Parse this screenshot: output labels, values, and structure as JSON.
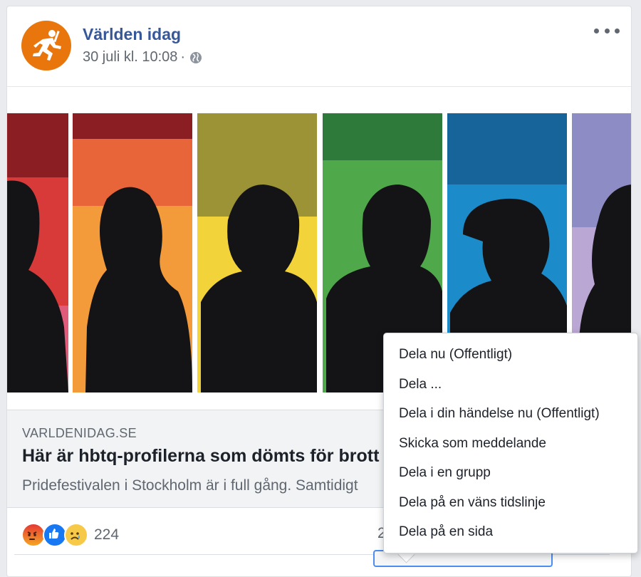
{
  "post": {
    "page_name": "Världen idag",
    "timestamp": "30 juli kl. 10:08",
    "separator": "·",
    "privacy_icon": "globe-icon",
    "avatar_icon": "running-figure-logo"
  },
  "link_preview": {
    "domain": "VARLDENIDAG.SE",
    "title": "Här är hbtq-profilerna som dömts för brott",
    "description": "Pridefestivalen i Stockholm är i full gång. Samtidigt"
  },
  "reactions": {
    "icons": [
      "angry-reaction-icon",
      "like-reaction-icon",
      "sad-reaction-icon"
    ],
    "count": "224",
    "comments_partial": "2"
  },
  "share_menu": {
    "items": [
      "Dela nu (Offentligt)",
      "Dela ...",
      "Dela i din händelse nu (Offentligt)",
      "Skicka som meddelande",
      "Dela i en grupp",
      "Dela på en väns tidslinje",
      "Dela på en sida"
    ]
  },
  "colors": {
    "page_name": "#365899",
    "avatar": "#e8760c",
    "focus_outline": "#4b8ef0",
    "stripes": [
      "#d83a3a",
      "#e8653a",
      "#c9b238",
      "#4fa84a",
      "#1b8cc9",
      "#8e8cc4"
    ]
  }
}
